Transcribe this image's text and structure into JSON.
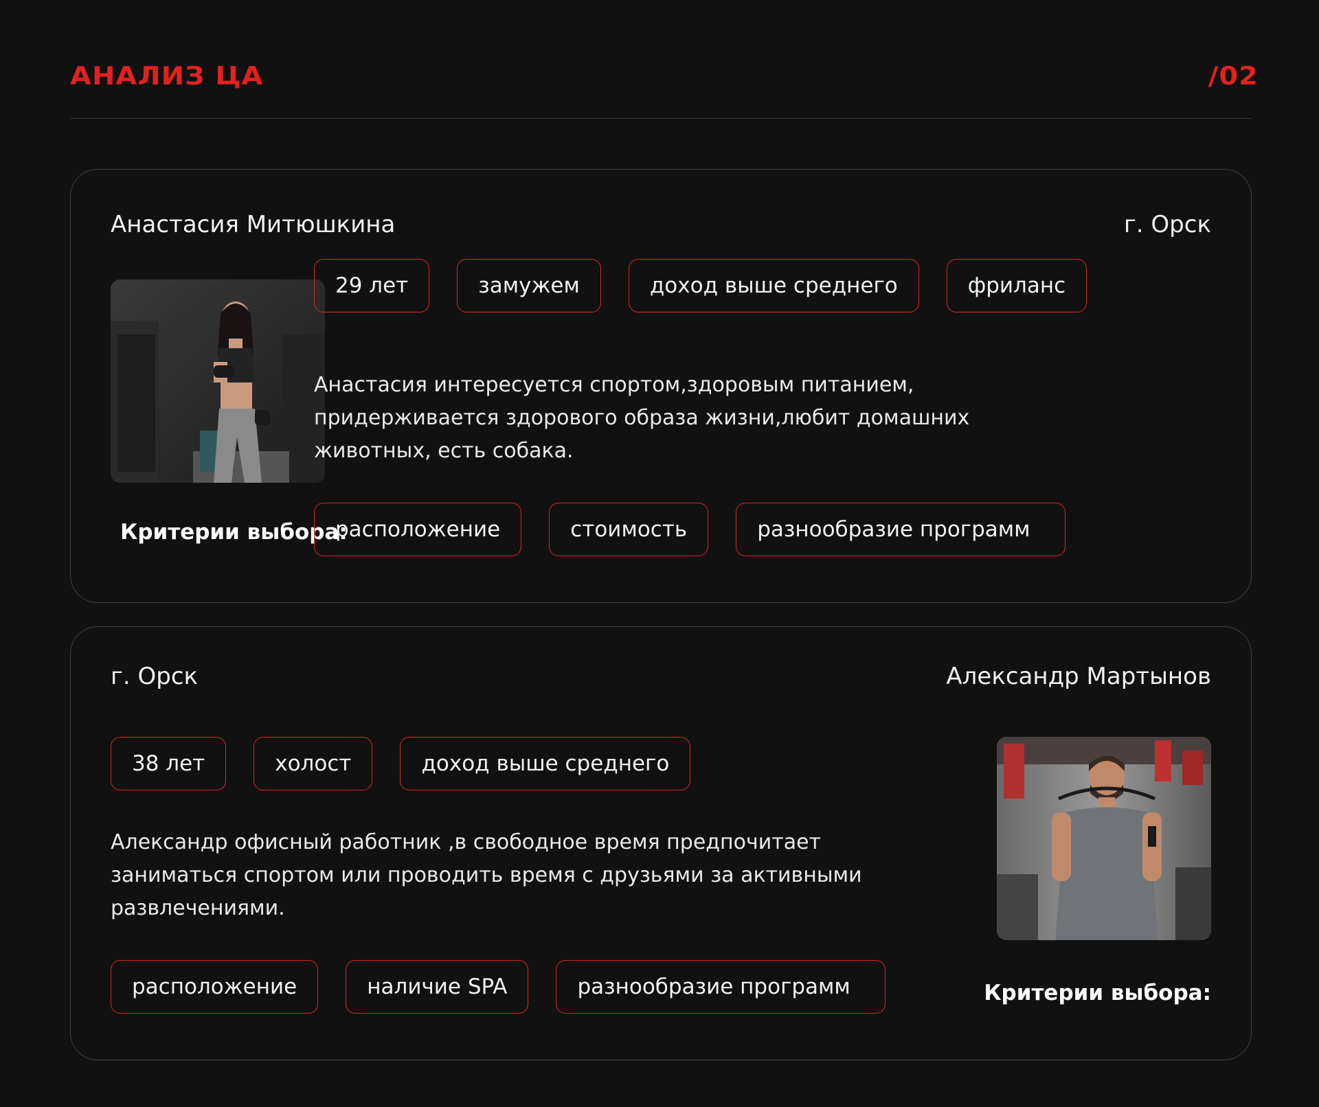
{
  "header": {
    "title": "АНАЛИЗ ЦА",
    "page_number": "/02",
    "accent_color": "#e3211e"
  },
  "persona1": {
    "name": "Анастасия Митюшкина",
    "city": "г. Орск",
    "photo_icon": "woman-with-dumbbells-photo",
    "tags": [
      "29 лет",
      "замужем",
      "доход выше среднего",
      "фриланс"
    ],
    "description": "Анастасия интересуется спортом,здоровым питанием, придерживается здорового образа жизни,любит домашних животных,  есть собака.",
    "criteria_label": "Критерии выбора:",
    "criteria": [
      "расположение",
      "стоимость",
      "разнообразие программ"
    ]
  },
  "persona2": {
    "name": "Александр Мартынов",
    "city": "г. Орск",
    "photo_icon": "man-with-jump-rope-photo",
    "tags": [
      "38 лет",
      "холост",
      "доход выше среднего"
    ],
    "description": "Александр офисный работник ,в свободное время предпочитает заниматься спортом или проводить время с друзьями за активными развлечениями.",
    "criteria_label": "Критерии выбора:",
    "criteria": [
      "расположение",
      "наличие SPA",
      "разнообразие программ"
    ]
  }
}
